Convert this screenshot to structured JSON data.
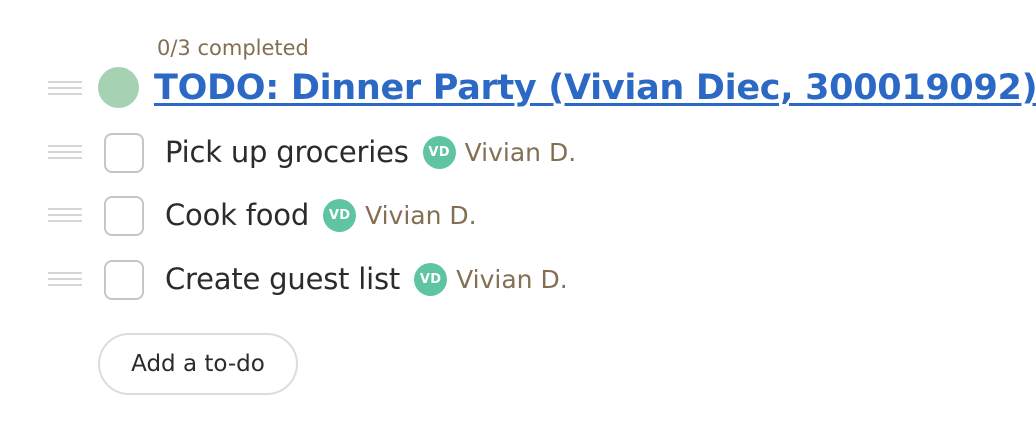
{
  "todolist": {
    "progress": "0/3 completed",
    "title": "TODO: Dinner Party (Vivian Diec, 300019092)",
    "dot_color": "#a7d1b3",
    "items": [
      {
        "text": "Pick up groceries",
        "completed": false,
        "assignee": {
          "initials": "VD",
          "name": "Vivian D."
        }
      },
      {
        "text": "Cook food",
        "completed": false,
        "assignee": {
          "initials": "VD",
          "name": "Vivian D."
        }
      },
      {
        "text": "Create guest list",
        "completed": false,
        "assignee": {
          "initials": "VD",
          "name": "Vivian D."
        }
      }
    ],
    "add_button_label": "Add a to-do"
  },
  "colors": {
    "title_link": "#2c69c5",
    "avatar": "#5ec4a2",
    "meta_text": "#846f53"
  },
  "icons": {
    "drag_handle": "drag-handle-icon",
    "list_dot": "list-color-dot-icon"
  }
}
